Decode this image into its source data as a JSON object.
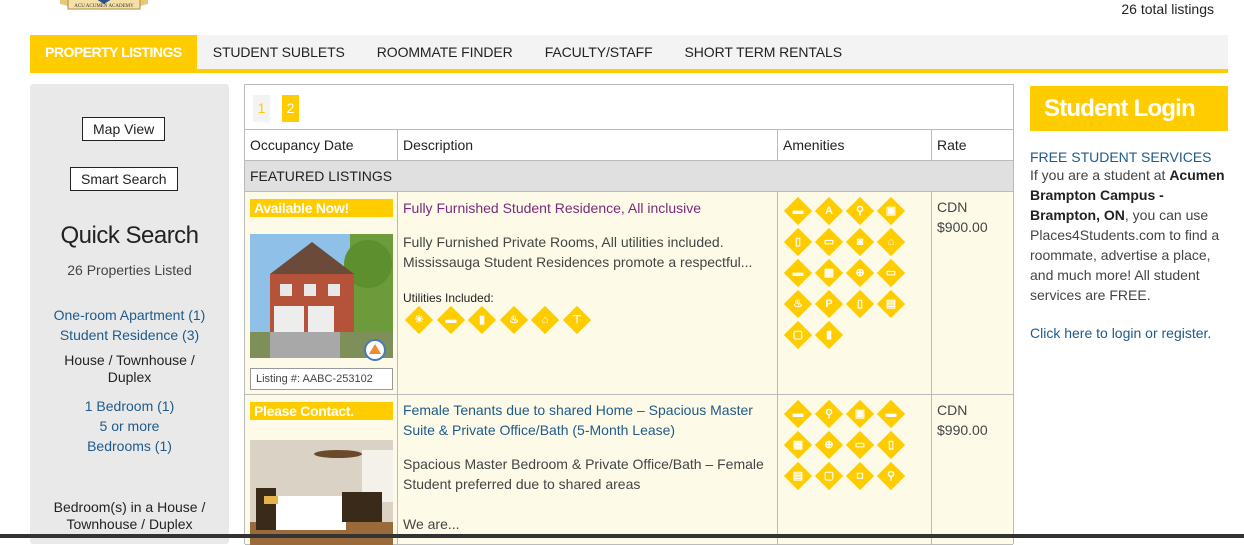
{
  "header": {
    "logo_text": "ACU ACUMEN ACADEMY",
    "total_listings": "26 total listings"
  },
  "nav": {
    "tabs": [
      "PROPERTY LISTINGS",
      "STUDENT SUBLETS",
      "ROOMMATE FINDER",
      "FACULTY/STAFF",
      "SHORT TERM RENTALS"
    ],
    "active": "PROPERTY LISTINGS"
  },
  "sidebar": {
    "map_view": "Map View",
    "smart_search": "Smart Search",
    "quick_search": "Quick Search",
    "properties_listed": "26 Properties Listed",
    "types": [
      "One-room Apartment (1)",
      "Student Residence (3)"
    ],
    "house_heading": "House / Townhouse / Duplex",
    "house_items": [
      "1 Bedroom (1)",
      "5 or more Bedrooms (1)"
    ],
    "bedroom_heading": "Bedroom(s) in a House / Townhouse / Duplex"
  },
  "pager": {
    "pages": [
      "1",
      "2"
    ],
    "current": "2"
  },
  "table": {
    "headers": [
      "Occupancy Date",
      "Description",
      "Amenities",
      "Rate"
    ],
    "featured_label": "FEATURED LISTINGS"
  },
  "listings": [
    {
      "badge": "Available Now!",
      "title": "Fully Furnished Student Residence, All inclusive",
      "description": "Fully Furnished Private Rooms, All utilities included. Mississauga Student Residences promote a respectful...",
      "utilities_label": "Utilities Included:",
      "listing_no": "Listing #: AABC-253102",
      "rate_currency": "CDN",
      "rate": "$900.00",
      "utility_icons": [
        "heat-icon",
        "ac-icon",
        "water-heater-icon",
        "gas-icon",
        "hydro-icon",
        "water-tap-icon"
      ],
      "amenity_icons": [
        "ac-unit-icon",
        "accessible-icon",
        "bike-icon",
        "bus-icon",
        "fridge-icon",
        "microwave-icon",
        "washer-icon",
        "home-icon",
        "bed-icon",
        "laundry-icon",
        "internet-icon",
        "tv-icon",
        "fire-icon",
        "parking-icon",
        "phone-icon",
        "dishwasher-icon",
        "oven-icon",
        "stove-icon"
      ]
    },
    {
      "badge": "Please Contact.",
      "title": "Female Tenants due to shared Home – Spacious Master Suite & Private Office/Bath (5-Month Lease)",
      "description": "Spacious Master Bedroom & Private Office/Bath – Female Student preferred due to shared areas",
      "more": "We are...",
      "rate_currency": "CDN",
      "rate": "$990.00",
      "amenity_icons": [
        "ac-unit-icon",
        "bike-icon",
        "bus-icon",
        "bed-icon",
        "laundry-icon",
        "internet-icon",
        "tv-icon",
        "phone-icon",
        "dishwasher-icon",
        "oven-icon",
        "cable-tv-icon",
        "bike-rack-icon"
      ]
    }
  ],
  "right": {
    "login_title": "Student Login",
    "services_heading": "FREE STUDENT SERVICES",
    "p1": "If you are a student at ",
    "campus": "Acumen Brampton Campus - Brampton, ON",
    "p2": ", you can use Places4Students.com to find a roommate, advertise a place, and much more! All student services are FREE.",
    "login_link": "Click here to login or register."
  },
  "colors": {
    "accent": "#ffcc00",
    "link": "#1f5a8a",
    "listing_title_1": "#7b2a7b",
    "listing_bg": "#fdfbe8"
  }
}
